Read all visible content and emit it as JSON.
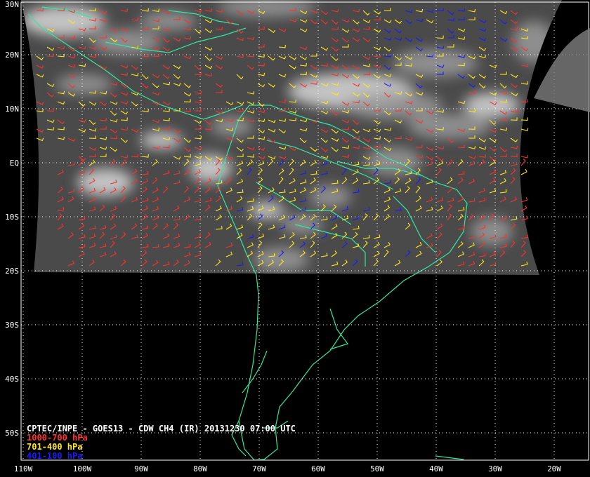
{
  "map": {
    "caption": "CPTEC/INPE - GOES13 - CDW CH4 (IR) 20131230 07:00 UTC",
    "legend": [
      {
        "label": "1000-700 hPa",
        "color": "#ff3030"
      },
      {
        "label": "701-400 hPa",
        "color": "#ffe81a"
      },
      {
        "label": "401-100 hPa",
        "color": "#1a1aff"
      }
    ],
    "lat_labels": [
      "30N",
      "20N",
      "10N",
      "EQ",
      "10S",
      "20S",
      "30S",
      "40S",
      "50S"
    ],
    "lon_labels": [
      "110W",
      "100W",
      "90W",
      "80W",
      "70W",
      "60W",
      "50W",
      "40W",
      "30W",
      "20W"
    ],
    "lat_values": [
      30,
      20,
      10,
      0,
      -10,
      -20,
      -30,
      -40,
      -50
    ],
    "lon_values": [
      -110,
      -100,
      -90,
      -80,
      -70,
      -60,
      -50,
      -40,
      -30,
      -20
    ],
    "coastline_color": "#2ee8a0",
    "grid_color": "#ffffff"
  }
}
